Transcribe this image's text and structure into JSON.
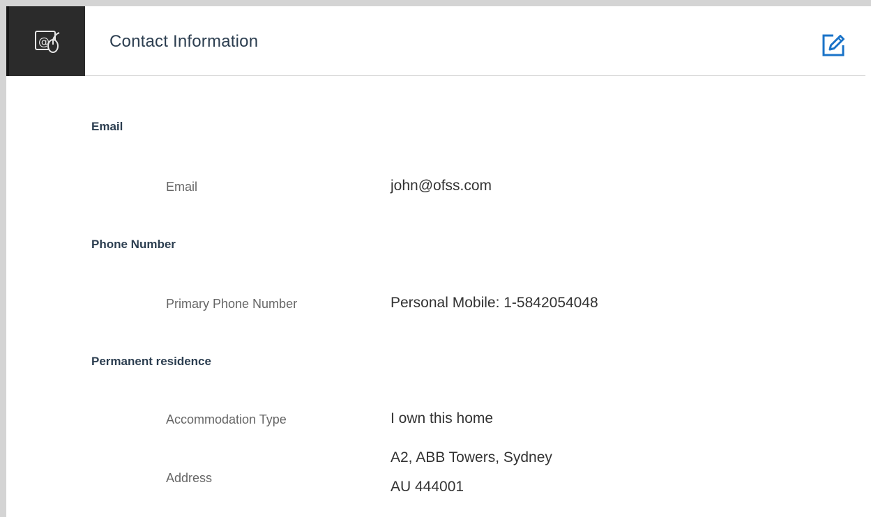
{
  "header": {
    "title": "Contact Information",
    "tile_icon": "email-mouse-icon",
    "edit_icon": "edit-icon",
    "accent_color": "#1a73c8"
  },
  "sections": {
    "email": {
      "heading": "Email",
      "fields": {
        "email": {
          "label": "Email",
          "value": "john@ofss.com"
        }
      }
    },
    "phone": {
      "heading": "Phone Number",
      "fields": {
        "primary": {
          "label": "Primary Phone Number",
          "value": "Personal Mobile: 1-5842054048"
        }
      }
    },
    "residence": {
      "heading": "Permanent residence",
      "fields": {
        "accommodation": {
          "label": "Accommodation Type",
          "value": "I own this home"
        },
        "address": {
          "label": "Address",
          "line1": "A2, ABB Towers, Sydney",
          "line2": "AU 444001"
        }
      }
    }
  }
}
